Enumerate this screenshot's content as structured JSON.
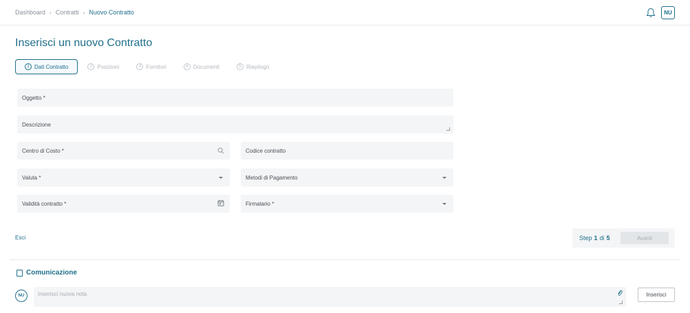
{
  "breadcrumb": [
    "Dashboard",
    "Contratti",
    "Nuovo Contratto"
  ],
  "user": {
    "initials": "NU"
  },
  "page_title": "Inserisci un nuovo Contratto",
  "steps": [
    {
      "num": "1",
      "label": "Dati Contratto",
      "active": true
    },
    {
      "num": "2",
      "label": "Posizioni"
    },
    {
      "num": "3",
      "label": "Fornitori"
    },
    {
      "num": "4",
      "label": "Documenti"
    },
    {
      "num": "5",
      "label": "Riepilogo"
    }
  ],
  "fields": {
    "oggetto": "Oggetto *",
    "descrizione": "Descrizione",
    "centro_costo": "Centro di Costo *",
    "codice_contratto": "Codice contratto",
    "valuta": "Valuta *",
    "metodi_pagamento": "Metodi di Pagamento",
    "validita": "Validità contratto *",
    "firmatario": "Firmatario *"
  },
  "footer": {
    "esci": "Esci",
    "step_prefix": "Step",
    "step_current": "1",
    "step_of": "di",
    "step_total": "5",
    "avanti": "Avanti"
  },
  "comunicazione": {
    "title": "Comunicazione",
    "avatar": "NU",
    "placeholder": "Inserisci nuova nota",
    "submit": "Inserisci"
  },
  "colors": {
    "accent": "#1f6f8b",
    "field_bg": "#f3f5f7"
  }
}
